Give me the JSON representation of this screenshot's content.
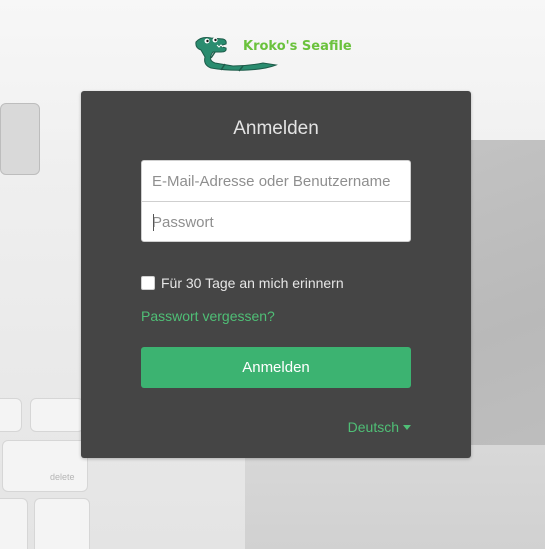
{
  "header": {
    "logo_text": "Kroko's Seafile",
    "logo_icon": "crocodile-logo"
  },
  "background": {
    "keys": [
      "delete"
    ]
  },
  "login": {
    "title": "Anmelden",
    "email_placeholder": "E-Mail-Adresse oder Benutzername",
    "password_placeholder": "Passwort",
    "remember_label": "Für 30 Tage an mich erinnern",
    "remember_checked": false,
    "forgot_link": "Passwort vergessen?",
    "submit_label": "Anmelden",
    "language": "Deutsch"
  },
  "colors": {
    "panel": "#454545",
    "accent": "#3cb371",
    "link": "#4fbf76",
    "logo_text": "#6ac23c"
  }
}
